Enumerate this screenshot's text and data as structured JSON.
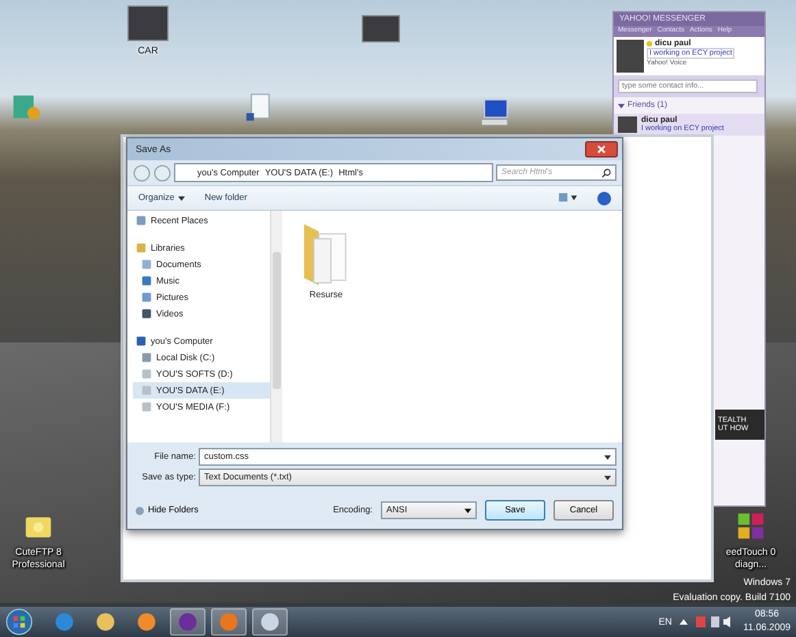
{
  "desktop_icons": [
    {
      "label": "CAR",
      "kind": "photo"
    },
    {
      "label": "CuteFTP 8 Professional",
      "kind": "ftp"
    },
    {
      "label": "eedTouch 0 diagn...",
      "kind": "tiles"
    }
  ],
  "windows_notice": [
    "Windows 7",
    "Evaluation copy. Build 7100"
  ],
  "messenger": {
    "title": "YAHOO! MESSENGER",
    "menu": [
      "Messenger",
      "Contacts",
      "Actions",
      "Help"
    ],
    "user": {
      "name": "dicu paul",
      "status": "I working on ECY project",
      "voice": "Yahoo! Voice"
    },
    "search": {
      "placeholder": "type some contact info..."
    },
    "groups": [
      {
        "label": "Friends (1)",
        "expanded": true,
        "contacts": [
          {
            "name": "dicu paul",
            "status": "I working on ECY project"
          }
        ]
      }
    ],
    "ad": [
      "TEALTH",
      "UT HOW"
    ]
  },
  "save_dialog": {
    "title": "Save As",
    "path": [
      "you's Computer",
      "YOU'S DATA (E:)",
      "Html's"
    ],
    "search": {
      "placeholder": "Search Html's"
    },
    "toolbar": [
      {
        "label": "Organize",
        "menu": true
      },
      {
        "label": "New folder",
        "menu": false
      }
    ],
    "nav": [
      {
        "label": "Recent Places",
        "kind": "recent",
        "selected": false
      },
      {
        "label": "Libraries",
        "kind": "library",
        "selected": false,
        "children": [
          {
            "label": "Documents",
            "kind": "documents",
            "selected": false
          },
          {
            "label": "Music",
            "kind": "music",
            "selected": false
          },
          {
            "label": "Pictures",
            "kind": "pictures",
            "selected": false
          },
          {
            "label": "Videos",
            "kind": "videos",
            "selected": false
          }
        ]
      },
      {
        "label": "you's Computer",
        "kind": "computer",
        "selected": false,
        "children": [
          {
            "label": "Local Disk (C:)",
            "kind": "disk",
            "selected": false
          },
          {
            "label": "YOU'S SOFTS (D:)",
            "kind": "drive",
            "selected": false
          },
          {
            "label": "YOU'S DATA (E:)",
            "kind": "drive",
            "selected": true
          },
          {
            "label": "YOU'S MEDIA (F:)",
            "kind": "drive",
            "selected": false
          }
        ]
      }
    ],
    "files": [
      {
        "name": "Resurse",
        "kind": "folder"
      }
    ],
    "file_name": {
      "label": "File name:",
      "value": "custom.css"
    },
    "save_type": {
      "label": "Save as type:",
      "value": "Text Documents (*.txt)"
    },
    "hide_folders": "Hide Folders",
    "encoding": {
      "label": "Encoding:",
      "value": "ANSI"
    },
    "buttons": [
      {
        "label": "Save",
        "default": true
      },
      {
        "label": "Cancel",
        "default": false
      }
    ]
  },
  "taskbar": {
    "apps": [
      {
        "kind": "ie",
        "open": false
      },
      {
        "kind": "explorer",
        "open": false
      },
      {
        "kind": "media",
        "open": false
      },
      {
        "kind": "yahoo",
        "open": true
      },
      {
        "kind": "firefox",
        "open": true
      },
      {
        "kind": "notepad",
        "open": true
      }
    ],
    "language": "EN",
    "time": "08:56",
    "date": "11.06.2009"
  }
}
